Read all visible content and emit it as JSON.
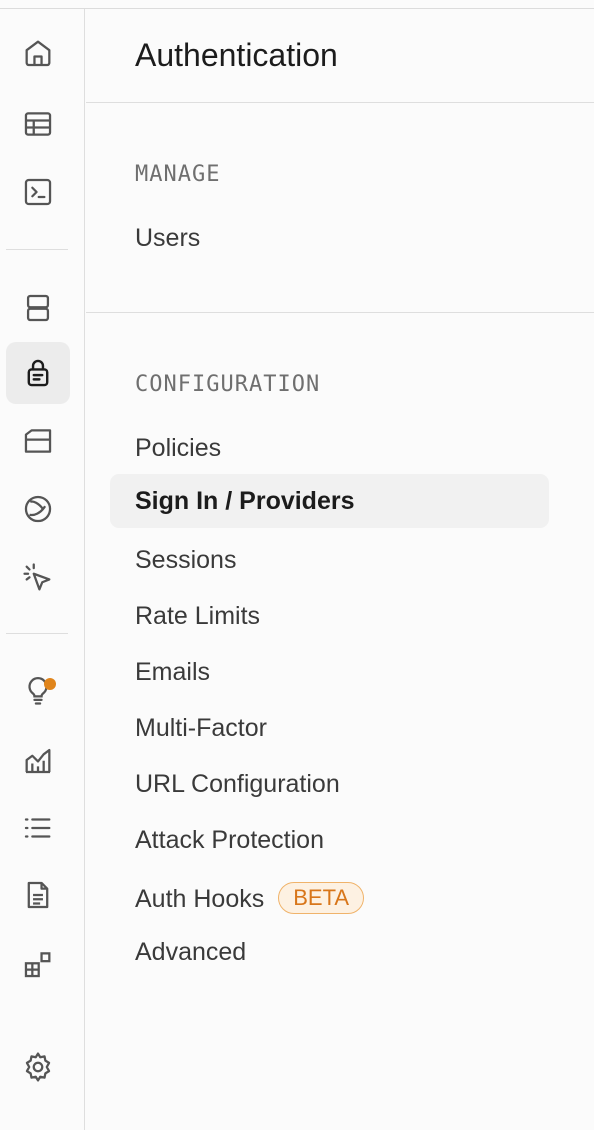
{
  "panel": {
    "title": "Authentication",
    "sections": [
      {
        "heading": "MANAGE",
        "items": [
          "Users"
        ]
      },
      {
        "heading": "CONFIGURATION",
        "items": [
          "Policies",
          "Sign In / Providers",
          "Sessions",
          "Rate Limits",
          "Emails",
          "Multi-Factor",
          "URL Configuration",
          "Attack Protection",
          "Auth Hooks",
          "Advanced"
        ]
      }
    ],
    "active_item": "Sign In / Providers",
    "badge": "BETA"
  },
  "rail": {
    "icons": [
      "home-icon",
      "table-icon",
      "terminal-icon",
      "database-icon",
      "lock-icon",
      "folder-icon",
      "realtime-icon",
      "cursor-click-icon",
      "lightbulb-icon",
      "reports-icon",
      "logs-list-icon",
      "document-icon",
      "integrations-icon",
      "settings-gear-icon"
    ],
    "active_icon": "lock-icon",
    "notification_color": "#e0851c"
  }
}
